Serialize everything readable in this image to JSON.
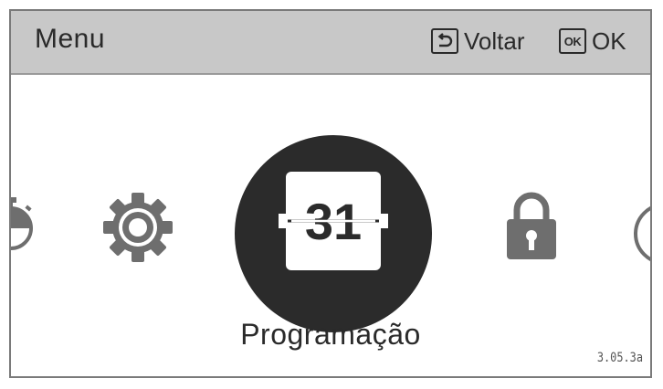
{
  "header": {
    "title": "Menu",
    "back_label": "Voltar",
    "ok_key": "OK",
    "ok_label": "OK"
  },
  "carousel": {
    "items": [
      {
        "icon": "stopwatch-icon",
        "partial": true
      },
      {
        "icon": "gear-icon"
      },
      {
        "icon": "calendar-icon",
        "selected": true,
        "day": "31"
      },
      {
        "icon": "lock-icon"
      },
      {
        "icon": "clock-icon",
        "partial": true
      }
    ],
    "selected_label": "Programação"
  },
  "footer": {
    "version": "3.05.3a"
  },
  "colors": {
    "header_bg": "#c8c8c8",
    "icon": "#6e6e6e",
    "selected_bg": "#2b2b2b"
  }
}
